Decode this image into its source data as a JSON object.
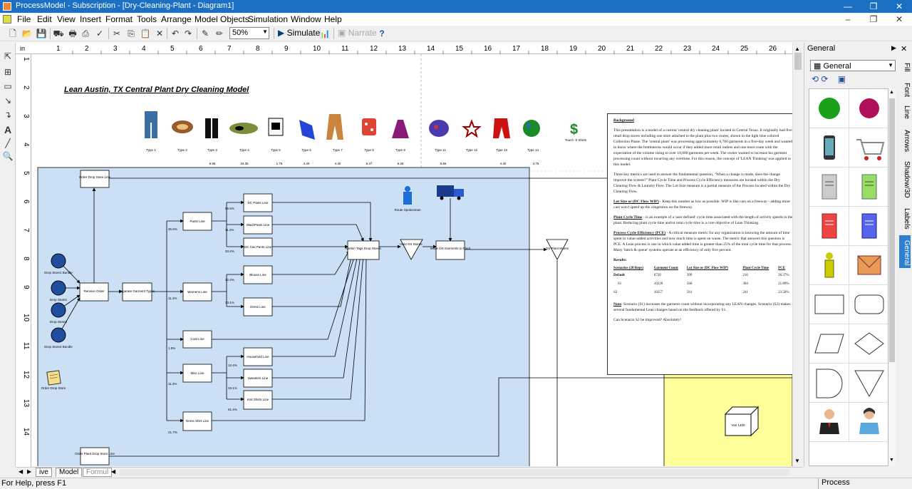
{
  "window": {
    "title": "ProcessModel - Subscription - [Dry-Cleaning-Plant - Diagram1]"
  },
  "menu": [
    "File",
    "Edit",
    "View",
    "Insert",
    "Format",
    "Tools",
    "Arrange",
    "Model Objects",
    "Simulation",
    "Window",
    "Help"
  ],
  "toolbar": {
    "zoom": "50%",
    "simulate": "Simulate",
    "narrate": "Narrate",
    "help": "?"
  },
  "ruler": {
    "unit": "in",
    "h": [
      "1",
      "2",
      "3",
      "4",
      "5",
      "6",
      "7",
      "8",
      "9",
      "10",
      "11",
      "12",
      "13",
      "14",
      "15",
      "16",
      "17",
      "18",
      "19",
      "20",
      "21",
      "22",
      "23",
      "24",
      "25",
      "26"
    ],
    "v": [
      "1",
      "2",
      "3",
      "4",
      "5",
      "6",
      "7",
      "8",
      "9",
      "10",
      "11",
      "12",
      "13",
      "14"
    ]
  },
  "diagram": {
    "title": "Lean Austin, TX Central Plant Dry Cleaning Model",
    "types": [
      "Type 1",
      "Type 2",
      "Type 3",
      "Type 4",
      "Type 5",
      "Type 6",
      "Type 7",
      "Type 8",
      "Type 9",
      "Type 11",
      "Type 12",
      "Type 13",
      "Type 14"
    ],
    "touch": "Touch -0 Shirts",
    "metrics": [
      "5.95",
      "16.35",
      "1.75",
      "4.40",
      "4.40",
      "5.37",
      "5.25",
      "6.65",
      "4.40",
      "3.75"
    ],
    "stores": [
      "Drop Store1 Bundle",
      "Drop Store1",
      "Drop Store2",
      "Drop Store4 Bundle"
    ],
    "nodes": {
      "order_drop_line": "Order Drop Store Line",
      "receive": "Receive Order",
      "separate": "Separate Garment Types",
      "pants": "Pants Line",
      "womens": "Womens Line",
      "coat": "Coat Line",
      "misc": "Misc Line",
      "dress_shirt": "Dress Shirt Line",
      "dc_pants": "DC Pants Line",
      "wash_pants": "WashPants Line",
      "dc_cas_pants": "DC Cas Pants Line",
      "blouse": "Blouse Line",
      "dress": "Dress Line",
      "household": "Household Line",
      "sweaters": "Sweaters Line",
      "knit_shirts": "Knit Shirts Line",
      "merkin": "Merkin Tags Drop Stores",
      "hold_os": "Hold OS Stores",
      "move_os": "Move OS Garments to Plant",
      "os_plant": "OS Plant Stores",
      "order_drop_paper": "Order Drop Store",
      "order_plant": "Order Plant Drop Store Line",
      "van": "Van 1400",
      "spokesman": "Route Spokesman"
    },
    "percents": [
      "55.5%",
      "11.2%",
      "33.4%",
      "35.5%",
      "11.1%",
      "1.5%",
      "11.3%",
      "21.7%",
      "12.2%",
      "33.1%",
      "55.4%",
      "12.4%",
      "33.1%",
      "61.4%"
    ],
    "text_panel": {
      "heading": "Background",
      "para1": "This presentation is a model of a current 'central dry cleaning plant' located in Central Texas. It originally had five retail drop stores including one store attached to the plant plus two routes, shown in the light blue colored Collection Phase. The 'central plant' was processing approximately 6,700 garments in a five-day week and wanted to know where the bottlenecks would occur if they added more retail outlets and one more route with the expectation of the volume rising to over 10,000 garments per week. The owner wanted to increase his garment processing count without incurring any overtime. For this reason, the concept of 'LEAN Thinking' was applied to this model.",
      "para2": "Three key metrics are used to answer the fundamental question, \"When a change is made, does the change improve the system?\" Plant Cycle Time and Process Cycle Efficiency measures are located within the Dry Cleaning Flow & Laundry Flow. The Lot Size measure is a partial measure of the Process located within the Dry Cleaning Flow.",
      "lot_h": "Lot Size or (DC Flow WIP)",
      "lot_t": " - Keep this number as low as possible. WIP is like cars on a freeway - adding more cars won't speed up the congestion on the freeway.",
      "pct_h": "Plant Cycle Time",
      "pct_t": " - is an example of a 'user defined' cycle time associated with the length of activity speeds in the plant. Reducing plant cycle time and/or total cycle time is a core objective of Lean Thinking.",
      "pce_h": "Process Cycle Efficiency (PCE)",
      "pce_t": " - A critical measure metric for any organization is knowing the amount of time spent in value-added activities and how much time is spent on waste. The metric that answers this question is PCE. A Lean process is one in which value added time is greater than 25% of the total cycle time for that process. Many 'batch & queue' systems operate at an efficiency of only five percent.",
      "results": "Results:",
      "cols": [
        "Scenarios (20 Reps)",
        "Garment Count",
        "Lot Size or (DC Flow WIP)",
        "Plant Cycle Time",
        "PCE"
      ],
      "rows": [
        [
          "Default",
          "6720",
          "399",
          "216",
          "26.37%"
        ],
        [
          "S1",
          "10220",
          "566",
          "304",
          "21.89%"
        ],
        [
          "S2",
          "10257",
          "561",
          "241",
          "23.58%"
        ]
      ],
      "note_h": "Note",
      "note_t": ": Scenario (S1) increases the garment count without incorporating any LEAN changes. Scenario (S2) makes several fundamental Lean changes based on the feedback offered by S1.",
      "q": "Can Scenario S2 be improved? Absolutely!"
    }
  },
  "tabs": [
    "ive",
    "Model",
    "Formul"
  ],
  "status": {
    "help": "For Help, press F1",
    "mode": "Process"
  },
  "panel": {
    "header": "General",
    "select": "General"
  },
  "side_tabs": [
    "Fill",
    "Font",
    "Line",
    "Arrows",
    "Shadow/3D",
    "Labels",
    "General"
  ],
  "colors": {
    "titlebar": "#1c70c4",
    "collection": "#cce0f5",
    "yellow": "#ffff99"
  }
}
